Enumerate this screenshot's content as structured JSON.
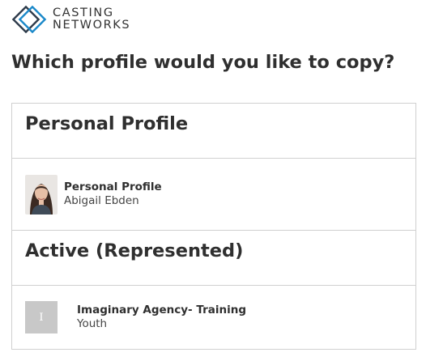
{
  "brand": {
    "line1": "CASTING",
    "line2": "NETWORKS",
    "accent": "#1a88c9",
    "dark": "#2d3a4a"
  },
  "page": {
    "title": "Which profile would you like to copy?"
  },
  "sections": [
    {
      "header": "Personal Profile",
      "items": [
        {
          "title": "Personal Profile",
          "subtitle": "Abigail Ebden",
          "avatar": "photo"
        }
      ]
    },
    {
      "header": "Active (Represented)",
      "items": [
        {
          "title": "Imaginary Agency- Training",
          "subtitle": "Youth",
          "avatar_initial": "I"
        }
      ]
    }
  ]
}
